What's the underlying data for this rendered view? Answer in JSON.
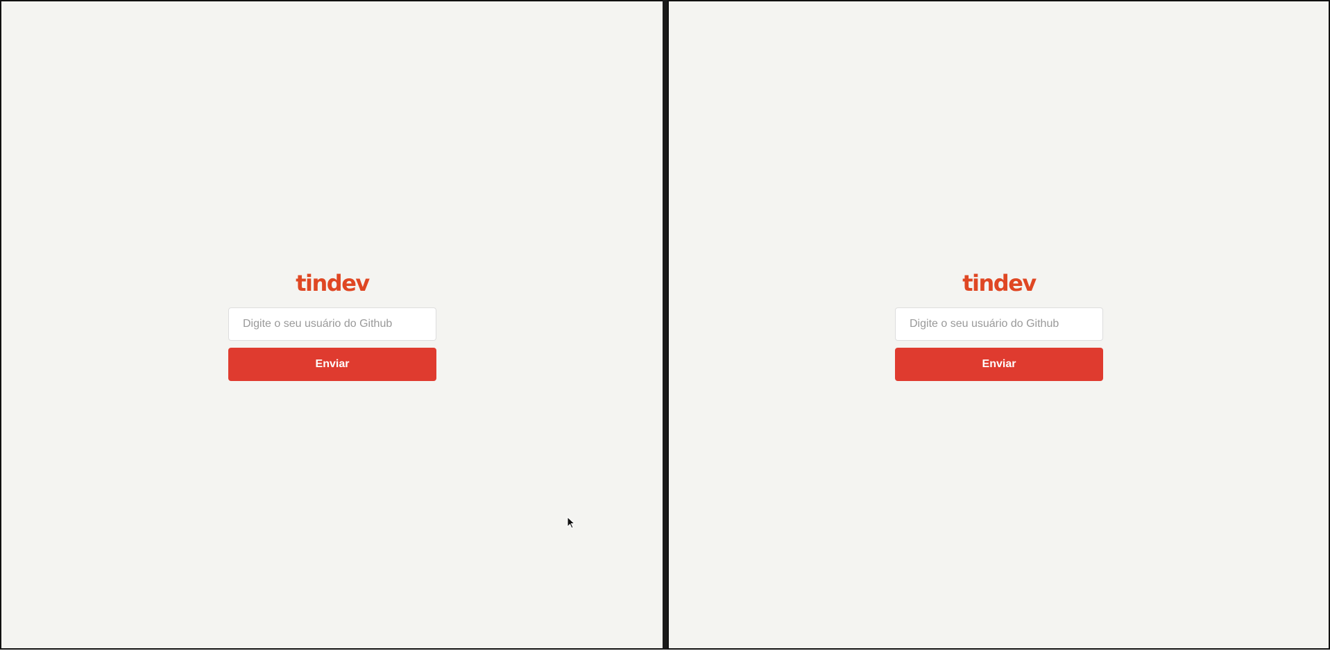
{
  "panes": [
    {
      "logo": {
        "text": "tindev",
        "color": "#df4723"
      },
      "form": {
        "username_placeholder": "Digite o seu usuário do Github",
        "submit_label": "Enviar"
      }
    },
    {
      "logo": {
        "text": "tindev",
        "color": "#df4723"
      },
      "form": {
        "username_placeholder": "Digite o seu usuário do Github",
        "submit_label": "Enviar"
      }
    }
  ],
  "colors": {
    "background": "#f4f4f1",
    "accent": "#df3b2f",
    "window_border": "#111111"
  },
  "cursor_icon": "mouse-pointer-icon"
}
